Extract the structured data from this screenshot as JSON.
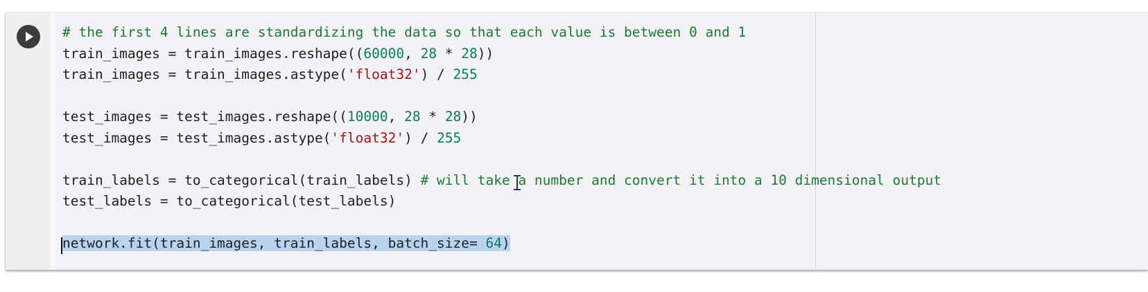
{
  "cell": {
    "run_button": {
      "icon": "play-icon"
    },
    "lines": [
      [
        {
          "t": "cm",
          "v": "# the first 4 lines are standardizing the data so that each value is between 0 and 1"
        }
      ],
      [
        {
          "t": "p",
          "v": "train_images = train_images.reshape(("
        },
        {
          "t": "num",
          "v": "60000"
        },
        {
          "t": "p",
          "v": ", "
        },
        {
          "t": "num",
          "v": "28"
        },
        {
          "t": "p",
          "v": " * "
        },
        {
          "t": "num",
          "v": "28"
        },
        {
          "t": "p",
          "v": "))"
        }
      ],
      [
        {
          "t": "p",
          "v": "train_images = train_images.astype("
        },
        {
          "t": "str",
          "v": "'float32'"
        },
        {
          "t": "p",
          "v": ") / "
        },
        {
          "t": "num",
          "v": "255"
        }
      ],
      [],
      [
        {
          "t": "p",
          "v": "test_images = test_images.reshape(("
        },
        {
          "t": "num",
          "v": "10000"
        },
        {
          "t": "p",
          "v": ", "
        },
        {
          "t": "num",
          "v": "28"
        },
        {
          "t": "p",
          "v": " * "
        },
        {
          "t": "num",
          "v": "28"
        },
        {
          "t": "p",
          "v": "))"
        }
      ],
      [
        {
          "t": "p",
          "v": "test_images = test_images.astype("
        },
        {
          "t": "str",
          "v": "'float32'"
        },
        {
          "t": "p",
          "v": ") / "
        },
        {
          "t": "num",
          "v": "255"
        }
      ],
      [],
      [
        {
          "t": "p",
          "v": "train_labels = to_categorical(train_labels) "
        },
        {
          "t": "cm",
          "v": "# will take a number and convert it into a 10 dimensional output"
        }
      ],
      [
        {
          "t": "p",
          "v": "test_labels = to_categorical(test_labels)"
        }
      ],
      [],
      [
        {
          "t": "sel",
          "v": "network.fit(train_images, train_labels, batch_size= "
        },
        {
          "t": "selnum",
          "v": "64"
        },
        {
          "t": "sel",
          "v": ")"
        }
      ]
    ]
  },
  "colors": {
    "comment": "#1e7a32",
    "number": "#0a7a5e",
    "string": "#a31515",
    "selection": "#b9d3ef",
    "run_button": "#3c3c3c"
  }
}
